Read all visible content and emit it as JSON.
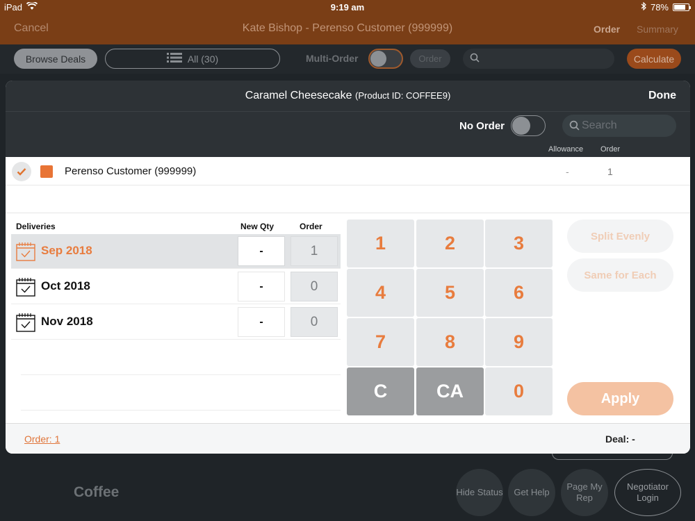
{
  "status_bar": {
    "device": "iPad",
    "time": "9:19 am",
    "battery": "78%",
    "battery_level": 0.78
  },
  "nav": {
    "cancel": "Cancel",
    "title": "Kate Bishop - Perenso Customer (999999)",
    "order_tab": "Order",
    "summary_tab": "Summary"
  },
  "toolbar": {
    "browse_deals": "Browse Deals",
    "all_filter": "All (30)",
    "multi_order": "Multi-Order",
    "order_button": "Order",
    "calculate": "Calculate"
  },
  "background": {
    "section_title": "Coffee",
    "hide_status": "Hide Status",
    "get_help": "Get Help",
    "page_my_rep": "Page My Rep",
    "negotiator_login": "Negotiator Login"
  },
  "modal": {
    "title": "Caramel Cheesecake",
    "product_id": "(Product ID: COFFEE9)",
    "done": "Done",
    "no_order": "No Order",
    "search_placeholder": "Search",
    "col_allowance": "Allowance",
    "col_order": "Order",
    "customer": {
      "name": "Perenso Customer (999999)",
      "allowance": "-",
      "order": "1"
    },
    "deliveries_header": "Deliveries",
    "new_qty_header": "New Qty",
    "order_header": "Order",
    "deliveries": [
      {
        "month": "Sep 2018",
        "new_qty": "-",
        "order": "1"
      },
      {
        "month": "Oct 2018",
        "new_qty": "-",
        "order": "0"
      },
      {
        "month": "Nov 2018",
        "new_qty": "-",
        "order": "0"
      }
    ],
    "keypad": [
      "1",
      "2",
      "3",
      "4",
      "5",
      "6",
      "7",
      "8",
      "9",
      "C",
      "CA",
      "0"
    ],
    "split_evenly": "Split Evenly",
    "same_for_each": "Same for Each",
    "apply": "Apply",
    "footer_order": "Order: 1",
    "footer_deal": "Deal: -"
  },
  "colors": {
    "accent": "#e87c3e",
    "header_dark": "#2d3236",
    "nav_brown": "#7a3e16"
  }
}
